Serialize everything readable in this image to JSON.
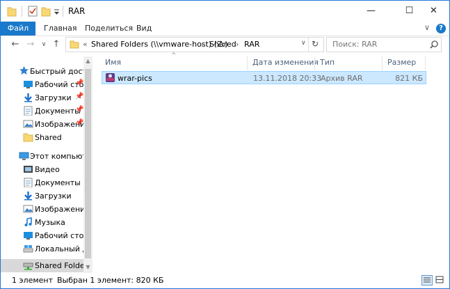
{
  "window": {
    "title": "RAR"
  },
  "caption_buttons": {
    "minimize": "—",
    "maximize": "☐",
    "close": "✕"
  },
  "ribbon": {
    "file_tab": "Файл",
    "tabs": [
      "Главная",
      "Поделиться",
      "Вид"
    ],
    "expand": "∨",
    "help": "?"
  },
  "nav": {
    "back": "←",
    "forward": "→",
    "recent": "∨",
    "up": "↑",
    "overflow": "«",
    "dropdown": "∨",
    "refresh": "↻"
  },
  "address": {
    "crumbs": [
      "Shared Folders (\\\\vmware-host) (Z:)",
      "Shared",
      "RAR"
    ],
    "separator": "›"
  },
  "search": {
    "placeholder": "Поиск: RAR",
    "icon": "search-icon"
  },
  "navpane": {
    "quick_access": "Быстрый доступ",
    "quick_items": [
      {
        "label": "Рабочий сто",
        "icon": "desktop-icon"
      },
      {
        "label": "Загрузки",
        "icon": "download-icon"
      },
      {
        "label": "Документы",
        "icon": "documents-icon"
      },
      {
        "label": "Изображени",
        "icon": "pictures-icon"
      },
      {
        "label": "Shared",
        "icon": "folder-icon"
      }
    ],
    "this_pc": "Этот компьютер",
    "pc_items": [
      {
        "label": "Видео",
        "icon": "video-icon"
      },
      {
        "label": "Документы",
        "icon": "documents-icon"
      },
      {
        "label": "Загрузки",
        "icon": "download-icon"
      },
      {
        "label": "Изображения",
        "icon": "pictures-icon"
      },
      {
        "label": "Музыка",
        "icon": "music-icon"
      },
      {
        "label": "Рабочий стол",
        "icon": "desktop-icon"
      },
      {
        "label": "Локальный дис",
        "icon": "local-disk-icon"
      },
      {
        "label": "Shared Folders (",
        "icon": "network-drive-icon"
      }
    ],
    "pin": "📌"
  },
  "columns": [
    "Имя",
    "Дата изменения",
    "Тип",
    "Размер"
  ],
  "sort_indicator": "^",
  "files": [
    {
      "name": "wrar-pics",
      "modified": "13.11.2018 20:33",
      "type": "Архив RAR",
      "size": "821 КБ"
    }
  ],
  "status": {
    "count": "1 элемент",
    "selected": "Выбран 1 элемент: 820 КБ"
  },
  "colors": {
    "accent": "#1979ca",
    "selection": "#cce8ff",
    "selection_border": "#99d1ff",
    "border": "#1c78d8"
  }
}
